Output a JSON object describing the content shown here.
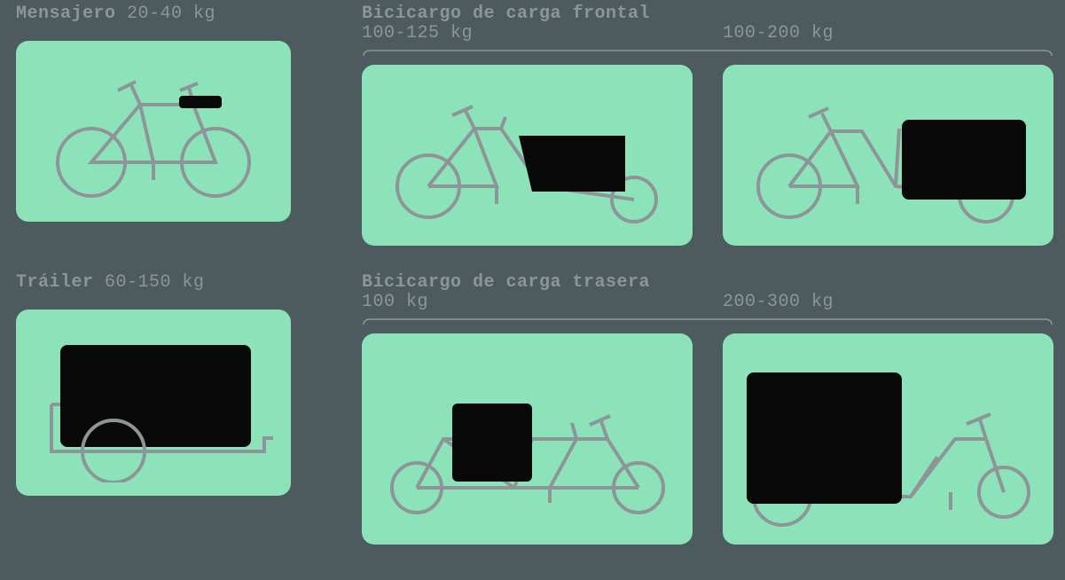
{
  "categories": {
    "courier": {
      "title": "Mensajero",
      "weight": "20-40 kg"
    },
    "front": {
      "title": "Bicicargo de carga frontal",
      "w1": "100-125 kg",
      "w2": "100-200 kg"
    },
    "trailer": {
      "title": "Tráiler",
      "weight": "60-150 kg"
    },
    "rear": {
      "title": "Bicicargo de carga trasera",
      "w1": "100 kg",
      "w2": "200-300 kg"
    }
  }
}
